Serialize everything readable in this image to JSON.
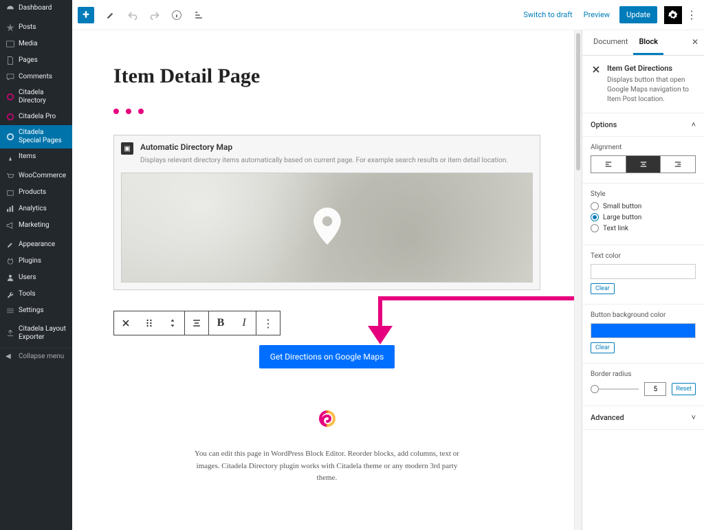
{
  "sidebar": {
    "items": [
      {
        "label": "Dashboard",
        "icon": "dashboard"
      },
      {
        "label": "Posts",
        "icon": "pin"
      },
      {
        "label": "Media",
        "icon": "media"
      },
      {
        "label": "Pages",
        "icon": "page"
      },
      {
        "label": "Comments",
        "icon": "comment"
      },
      {
        "label": "Citadela Directory",
        "icon": "swirl"
      },
      {
        "label": "Citadela Pro",
        "icon": "swirl"
      },
      {
        "label": "Citadela Special Pages",
        "icon": "swirl",
        "active": true
      },
      {
        "label": "Items",
        "icon": "pin"
      },
      {
        "label": "WooCommerce",
        "icon": "cart"
      },
      {
        "label": "Products",
        "icon": "box"
      },
      {
        "label": "Analytics",
        "icon": "bars"
      },
      {
        "label": "Marketing",
        "icon": "megaphone"
      },
      {
        "label": "Appearance",
        "icon": "brush"
      },
      {
        "label": "Plugins",
        "icon": "plug"
      },
      {
        "label": "Users",
        "icon": "user"
      },
      {
        "label": "Tools",
        "icon": "wrench"
      },
      {
        "label": "Settings",
        "icon": "sliders"
      },
      {
        "label": "Citadela Layout Exporter",
        "icon": "export"
      }
    ],
    "collapse_label": "Collapse menu"
  },
  "topbar": {
    "switch_draft": "Switch to draft",
    "preview": "Preview",
    "update": "Update"
  },
  "canvas": {
    "page_title": "Item Detail Page",
    "map_block": {
      "title": "Automatic Directory Map",
      "desc": "Displays relevant directory items automatically based on current page. For example search results or item detail location."
    },
    "directions_label": "Get Directions on Google Maps",
    "footer_text": "You can edit this page in WordPress Block Editor. Reorder blocks, add columns, text or images.  Citadela Directory plugin works with Citadela theme or any modern 3rd party theme."
  },
  "inspector": {
    "tabs": {
      "document": "Document",
      "block": "Block"
    },
    "block_info": {
      "title": "Item Get Directions",
      "desc": "Displays button that open Google Maps navigation to Item Post location."
    },
    "options_label": "Options",
    "alignment_label": "Alignment",
    "style_label": "Style",
    "style_options": {
      "small": "Small button",
      "large": "Large button",
      "text": "Text link"
    },
    "text_color_label": "Text color",
    "bg_color_label": "Button background color",
    "bg_color_value": "#006fff",
    "clear_label": "Clear",
    "border_radius_label": "Border radius",
    "border_radius_value": "5",
    "reset_label": "Reset",
    "advanced_label": "Advanced"
  }
}
